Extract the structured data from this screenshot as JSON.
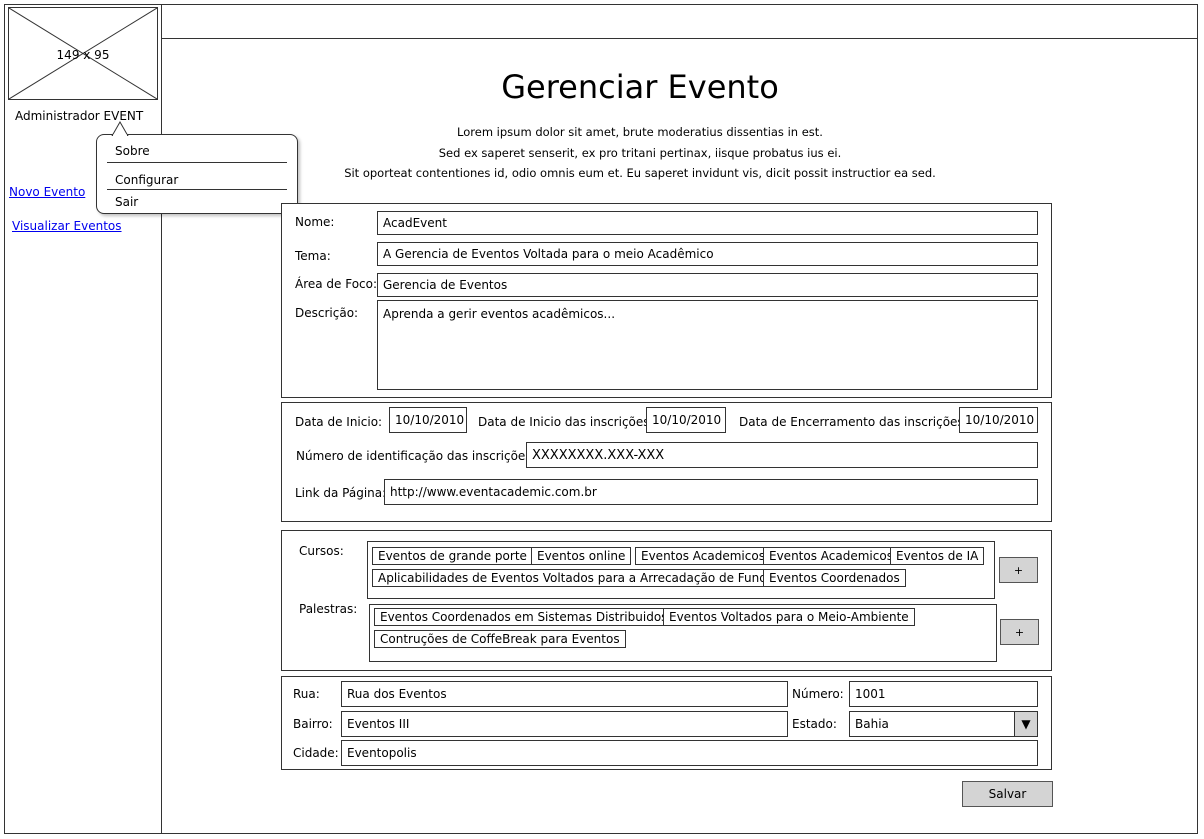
{
  "logo": {
    "placeholder": "149 x 95"
  },
  "user": {
    "name": "Administrador EVENT"
  },
  "user_menu": {
    "items": [
      "Sobre",
      "Configurar",
      "Sair"
    ]
  },
  "nav": {
    "new_event": "Novo Evento",
    "view_events": "Visualizar Eventos"
  },
  "page": {
    "title": "Gerenciar Evento",
    "lorem": [
      "Lorem ipsum dolor sit amet, brute moderatius dissentias in est.",
      "Sed ex saperet senserit, ex pro tritani pertinax, iisque probatus ius ei.",
      "Sit oporteat contentiones id, odio omnis eum et. Eu saperet invidunt vis, dicit possit instructior ea sed."
    ]
  },
  "event": {
    "name_label": "Nome:",
    "name_value": "AcadEvent",
    "theme_label": "Tema:",
    "theme_value": "A Gerencia de Eventos Voltada para o meio Acadêmico",
    "focus_label": "Área de Foco:",
    "focus_value": "Gerencia de Eventos",
    "desc_label": "Descrição:",
    "desc_value": "Aprenda a gerir eventos acadêmicos..."
  },
  "dates": {
    "start_label": "Data de Inicio:",
    "start_value": "10/10/2010",
    "reg_start_label": "Data de Inicio das inscrições:",
    "reg_start_value": "10/10/2010",
    "reg_end_label": "Data de Encerramento das inscrições:",
    "reg_end_value": "10/10/2010",
    "reg_id_label": "Número de identificação das inscrições:",
    "reg_id_value": "XXXXXXXX.XXX-XXX",
    "link_label": "Link da Página:",
    "link_value": "http://www.eventacademic.com.br"
  },
  "courses": {
    "label": "Cursos:",
    "tags": [
      "Eventos de grande porte",
      "Eventos online",
      "Eventos Academicos",
      "Eventos Academicos",
      "Eventos de IA",
      "Aplicabilidades de Eventos Voltados para a Arrecadação de Fundos",
      "Eventos Coordenados"
    ],
    "add_label": "+"
  },
  "lectures": {
    "label": "Palestras:",
    "tags": [
      "Eventos Coordenados em Sistemas Distribuidos",
      "Eventos Voltados para o Meio-Ambiente",
      "Contruções de CoffeBreak para Eventos"
    ],
    "add_label": "+"
  },
  "address": {
    "street_label": "Rua:",
    "street_value": "Rua dos Eventos",
    "number_label": "Número:",
    "number_value": "1001",
    "district_label": "Bairro:",
    "district_value": "Eventos III",
    "state_label": "Estado:",
    "state_value": "Bahia",
    "city_label": "Cidade:",
    "city_value": "Eventopolis"
  },
  "actions": {
    "save": "Salvar"
  }
}
